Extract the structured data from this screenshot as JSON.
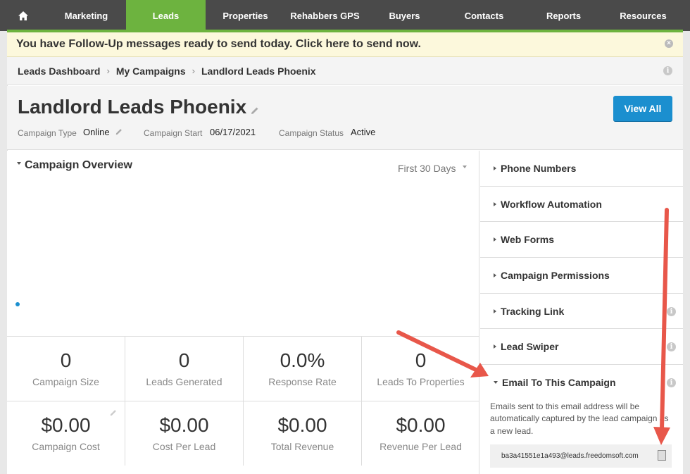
{
  "nav": {
    "tabs": [
      "Marketing",
      "Leads",
      "Properties",
      "Rehabbers GPS",
      "Buyers",
      "Contacts",
      "Reports",
      "Resources"
    ],
    "active": "Leads"
  },
  "alert": {
    "text": "You have Follow-Up messages ready to send today. Click here to send now."
  },
  "breadcrumb": [
    "Leads Dashboard",
    "My Campaigns",
    "Landlord Leads Phoenix"
  ],
  "campaign": {
    "title": "Landlord Leads Phoenix",
    "type_label": "Campaign Type",
    "type_value": "Online",
    "start_label": "Campaign Start",
    "start_value": "06/17/2021",
    "status_label": "Campaign Status",
    "status_value": "Active",
    "view_all": "View All"
  },
  "overview": {
    "title": "Campaign Overview",
    "range": "First 30 Days",
    "stats_row1": [
      {
        "value": "0",
        "label": "Campaign Size"
      },
      {
        "value": "0",
        "label": "Leads Generated"
      },
      {
        "value": "0.0%",
        "label": "Response Rate"
      },
      {
        "value": "0",
        "label": "Leads To Properties"
      }
    ],
    "stats_row2": [
      {
        "value": "$0.00",
        "label": "Campaign Cost"
      },
      {
        "value": "$0.00",
        "label": "Cost Per Lead"
      },
      {
        "value": "$0.00",
        "label": "Total Revenue"
      },
      {
        "value": "$0.00",
        "label": "Revenue Per Lead"
      }
    ]
  },
  "sidebar": {
    "items": [
      "Phone Numbers",
      "Workflow Automation",
      "Web Forms",
      "Campaign Permissions",
      "Tracking Link",
      "Lead Swiper"
    ],
    "email": {
      "title": "Email To This Campaign",
      "description": "Emails sent to this email address will be automatically captured by the lead campaign as a new lead.",
      "address": "ba3a41551e1a493@leads.freedomsoft.com"
    }
  },
  "colors": {
    "accent_green": "#6db33f",
    "accent_blue": "#1b8fcf",
    "arrow_red": "#e8574a"
  }
}
